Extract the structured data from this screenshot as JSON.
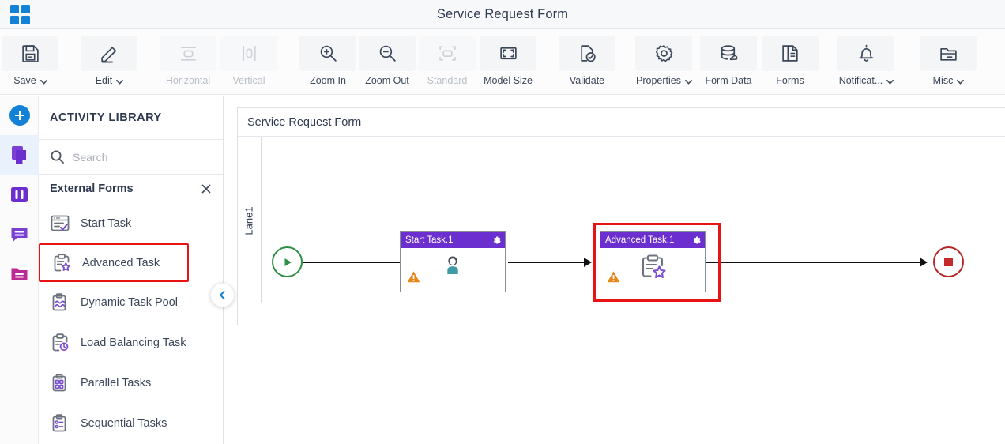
{
  "app": {
    "logo_icon": "grid-apps-icon",
    "title": "Service Request Form"
  },
  "toolbar": {
    "items": [
      {
        "label": "Save",
        "icon": "save-icon",
        "has_caret": true,
        "disabled": false
      },
      {
        "label": "Edit",
        "icon": "pencil-icon",
        "has_caret": true,
        "disabled": false
      },
      {
        "label": "Horizontal",
        "icon": "horizontal-align-icon",
        "has_caret": false,
        "disabled": true
      },
      {
        "label": "Vertical",
        "icon": "vertical-align-icon",
        "has_caret": false,
        "disabled": true
      },
      {
        "label": "Zoom In",
        "icon": "zoom-in-icon",
        "has_caret": false,
        "disabled": false
      },
      {
        "label": "Zoom Out",
        "icon": "zoom-out-icon",
        "has_caret": false,
        "disabled": false
      },
      {
        "label": "Standard",
        "icon": "standard-size-icon",
        "has_caret": false,
        "disabled": true
      },
      {
        "label": "Model Size",
        "icon": "model-size-icon",
        "has_caret": false,
        "disabled": false
      },
      {
        "label": "Validate",
        "icon": "validate-icon",
        "has_caret": false,
        "disabled": false
      },
      {
        "label": "Properties",
        "icon": "gear-icon",
        "has_caret": true,
        "disabled": false
      },
      {
        "label": "Form Data",
        "icon": "database-icon",
        "has_caret": false,
        "disabled": false
      },
      {
        "label": "Forms",
        "icon": "document-icon",
        "has_caret": false,
        "disabled": false
      },
      {
        "label": "Notificat...",
        "icon": "bell-icon",
        "has_caret": true,
        "disabled": false
      },
      {
        "label": "Misc",
        "icon": "folder-misc-icon",
        "has_caret": true,
        "disabled": false
      }
    ]
  },
  "rail": {
    "items": [
      {
        "name": "add-button",
        "icon": "plus-circle-icon",
        "active": false
      },
      {
        "name": "activities-panel",
        "icon": "pages-stack-icon",
        "active": true
      },
      {
        "name": "swimlanes-panel",
        "icon": "columns-icon",
        "active": false
      },
      {
        "name": "comments-panel",
        "icon": "chat-bubble-icon",
        "active": false
      },
      {
        "name": "files-panel",
        "icon": "folder-icon",
        "active": false
      }
    ]
  },
  "library": {
    "header": "ACTIVITY LIBRARY",
    "search": {
      "value": "",
      "placeholder": "Search",
      "icon": "search-icon"
    },
    "group": {
      "title": "External Forms",
      "close_icon": "close-icon"
    },
    "items": [
      {
        "label": "Start Task",
        "icon": "start-task-icon",
        "selected": false
      },
      {
        "label": "Advanced Task",
        "icon": "advanced-task-icon",
        "selected": true
      },
      {
        "label": "Dynamic Task Pool",
        "icon": "dynamic-task-icon",
        "selected": false
      },
      {
        "label": "Load Balancing Task",
        "icon": "load-balancing-icon",
        "selected": false
      },
      {
        "label": "Parallel Tasks",
        "icon": "parallel-tasks-icon",
        "selected": false
      },
      {
        "label": "Sequential Tasks",
        "icon": "sequential-tasks-icon",
        "selected": false
      }
    ],
    "collapse_icon": "chevron-left-icon"
  },
  "canvas": {
    "title": "Service Request Form",
    "lane_label": "Lane1",
    "nodes": {
      "start_event": {
        "name": "start-event",
        "icon": "play-icon"
      },
      "task1": {
        "title": "Start Task.1",
        "gear_icon": "gear-icon",
        "body_icon": "user-icon",
        "warning_icon": "warning-icon",
        "selected": false
      },
      "task2": {
        "title": "Advanced Task.1",
        "gear_icon": "gear-icon",
        "body_icon": "advanced-task-icon",
        "warning_icon": "warning-icon",
        "selected": true
      },
      "end_event": {
        "name": "end-event",
        "icon": "stop-square-icon"
      }
    }
  },
  "colors": {
    "accent_blue": "#1281d6",
    "task_purple": "#6a2fce",
    "selection_red": "#e81313",
    "start_green": "#2f8f46",
    "end_red": "#b82626",
    "warning_orange": "#e8881a",
    "icon_purple": "#7a4fd0"
  }
}
